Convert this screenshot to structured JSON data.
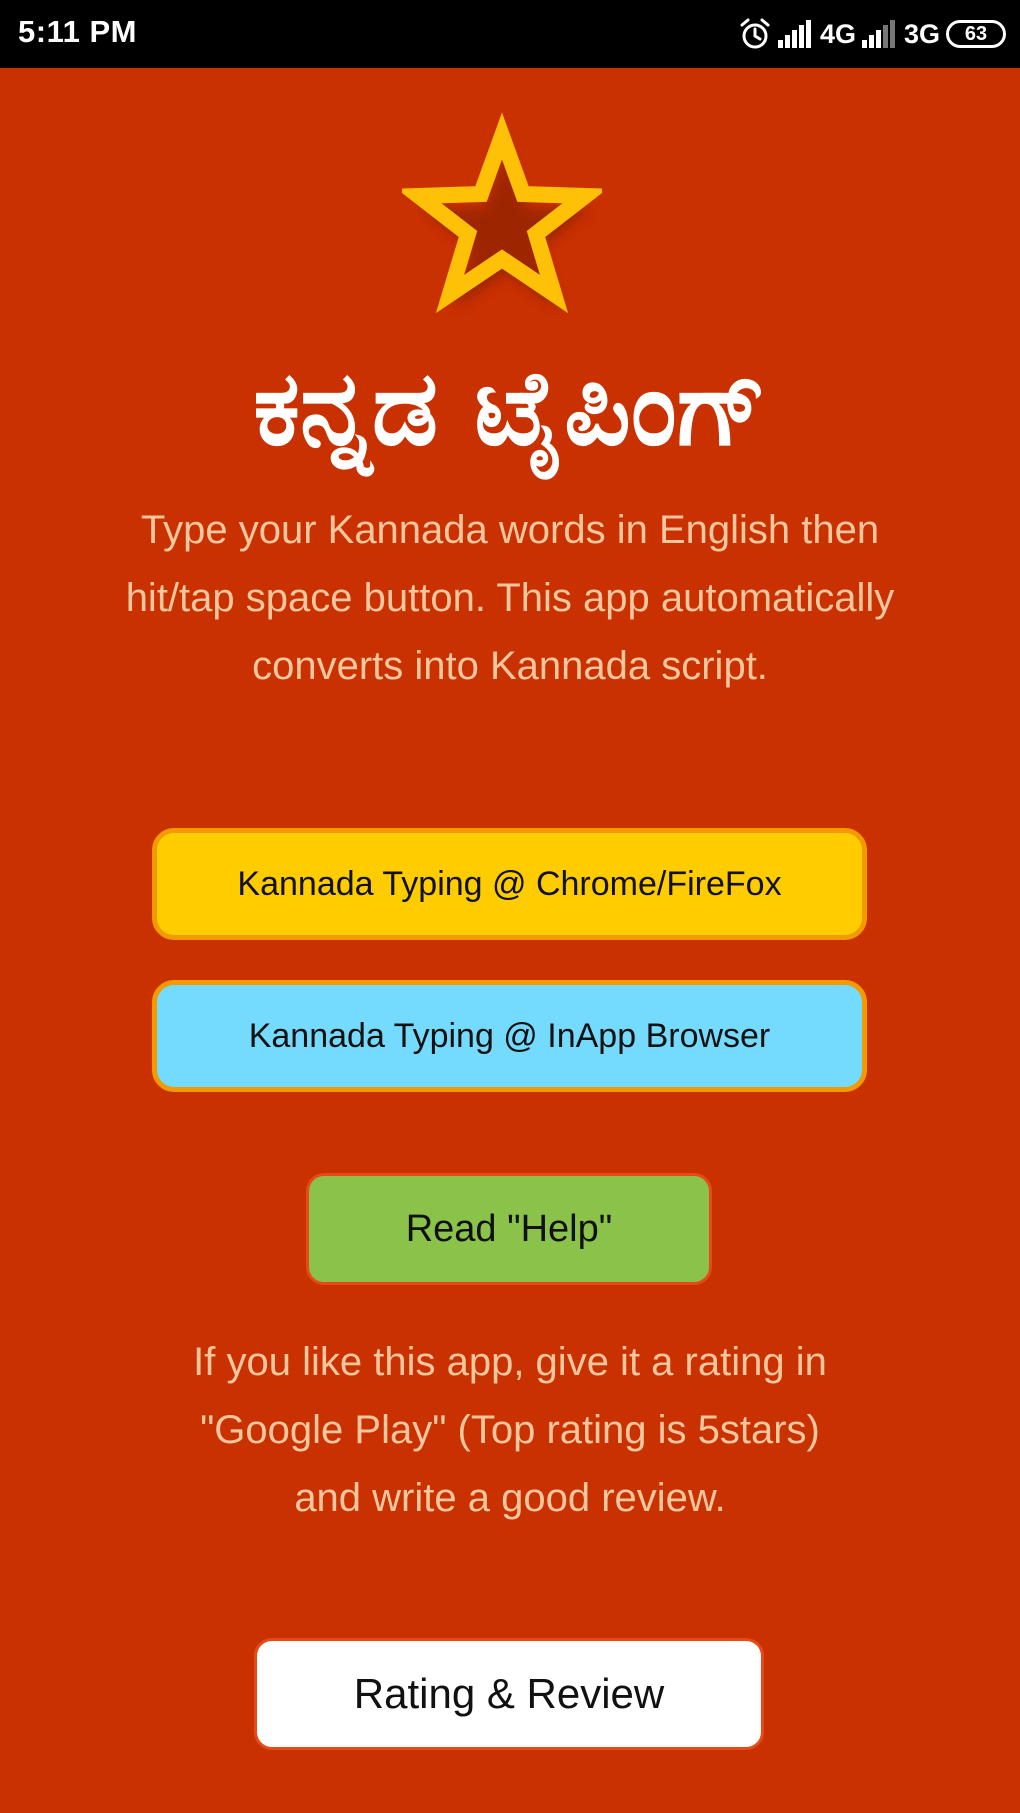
{
  "status_bar": {
    "time": "5:11 PM",
    "network_1": "4G",
    "network_2": "3G",
    "battery": "63",
    "icons": [
      "alarm-icon",
      "signal-icon",
      "signal-icon",
      "battery-icon"
    ]
  },
  "app": {
    "title": "ಕನ್ನಡ ಟೈಪಿಂಗ್",
    "intro_text": "Type your Kannada words in English then hit/tap space button. This app automatically converts into Kannada script.",
    "buttons": {
      "chrome": "Kannada Typing @ Chrome/FireFox",
      "inapp": "Kannada Typing @ InApp Browser",
      "help": "Read \"Help\"",
      "rating": "Rating & Review"
    },
    "rating_text": "If you like this app, give it a rating in \"Google Play\" (Top rating is 5stars) and write a good review.",
    "icon": "star-icon"
  },
  "colors": {
    "background": "#c93100",
    "body_text": "#f6c79e",
    "chrome_button": "#ffcc00",
    "inapp_button": "#74dbff",
    "help_button": "#8bc34a",
    "rating_button": "#ffffff",
    "star": "#ffc107"
  }
}
